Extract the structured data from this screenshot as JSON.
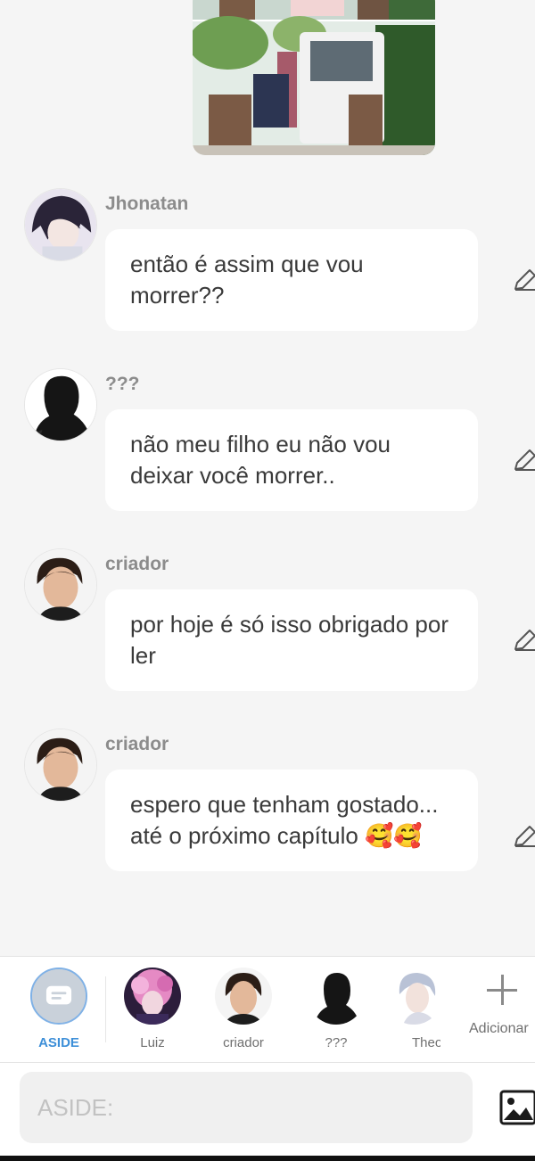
{
  "messages": [
    {
      "name": "Jhonatan",
      "text": "então é assim que vou morrer??",
      "avatar": "anime-boy-dark-hair-avatar"
    },
    {
      "name": "???",
      "text": "não meu filho eu não vou deixar você morrer..",
      "avatar": "silhouette-avatar"
    },
    {
      "name": "criador",
      "text": "por hoje é só isso obrigado por ler",
      "avatar": "man-photo-avatar"
    },
    {
      "name": "criador",
      "text": "espero que tenham gostado... até o próximo capítulo 🥰🥰",
      "avatar": "man-photo-avatar"
    }
  ],
  "characters": [
    {
      "label": "ASIDE",
      "active": true,
      "icon": "chat-bubble-icon"
    },
    {
      "label": "Luiz",
      "icon": "pink-hair-avatar"
    },
    {
      "label": "criador",
      "icon": "man-photo-avatar"
    },
    {
      "label": "???",
      "icon": "silhouette-avatar"
    },
    {
      "label": "Theo",
      "icon": "white-hair-avatar"
    }
  ],
  "add_label": "Adicionar",
  "input": {
    "placeholder": "ASIDE:"
  },
  "colors": {
    "background": "#f5f5f5",
    "accent": "#3d8fd8",
    "bubble": "#ffffff"
  }
}
